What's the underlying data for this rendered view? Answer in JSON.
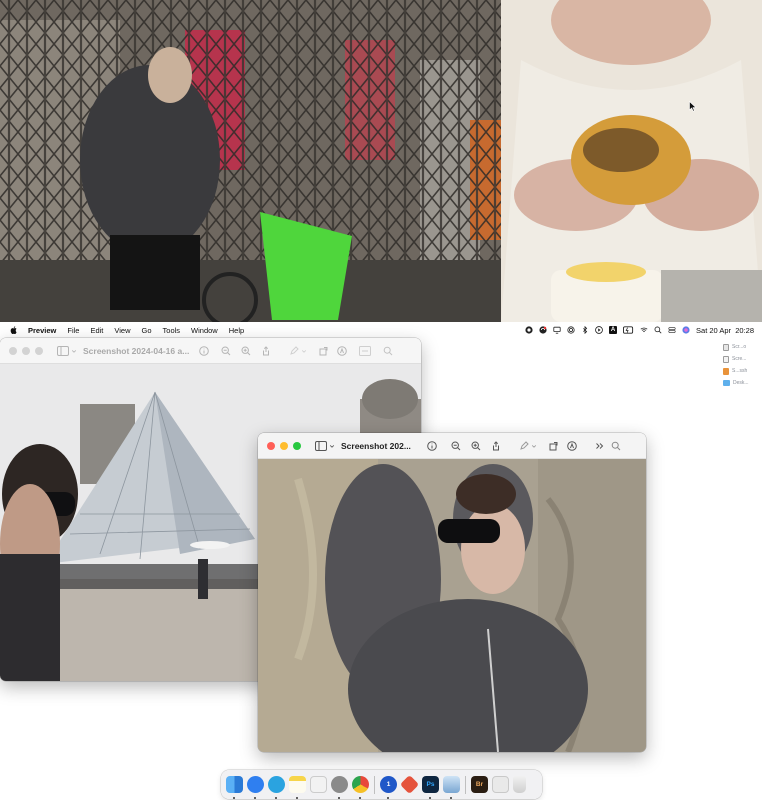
{
  "colors": {
    "menubar_bg": "#ffffff",
    "traffic_close": "#ff5f57",
    "traffic_minimize": "#febc2e",
    "traffic_zoom": "#28c840",
    "inactive_traffic": "#d3d3d3",
    "dock_bg": "#f0f0f2"
  },
  "menubar": {
    "apple_icon": "apple-icon",
    "items": [
      "Preview",
      "File",
      "Edit",
      "View",
      "Go",
      "Tools",
      "Window",
      "Help"
    ],
    "status_icons": [
      "creative-cloud-icon",
      "sync-icon",
      "display-icon",
      "airdrop-icon",
      "bluetooth-icon",
      "play-icon",
      "keyboard-a-icon",
      "battery-icon",
      "wifi-icon",
      "search-icon",
      "toggle-icon",
      "siri-icon"
    ],
    "keyboard_label": "A",
    "datetime": "Sat 20 Apr  20:28"
  },
  "desktop_files": [
    {
      "name": "Scr...o",
      "icon": "document-icon"
    },
    {
      "name": "Scre...",
      "icon": "document-icon"
    },
    {
      "name": "S...ssh",
      "icon": "image-file-icon"
    },
    {
      "name": "Desk...",
      "icon": "folder-icon"
    }
  ],
  "windows": [
    {
      "id": "back",
      "title": "Screenshot 2024-04-16 a...",
      "active": false,
      "toolbar_icons": [
        "sidebar-icon",
        "chevron-down-icon",
        "info-icon",
        "zoom-out-icon",
        "zoom-in-icon",
        "share-icon",
        "markup-icon",
        "chevron-down-icon",
        "rotate-icon",
        "markup-circle-icon",
        "form-fill-icon",
        "search-icon"
      ]
    },
    {
      "id": "front",
      "title": "Screenshot 202...",
      "active": true,
      "toolbar_icons": [
        "sidebar-icon",
        "chevron-down-icon",
        "info-icon",
        "zoom-out-icon",
        "zoom-in-icon",
        "share-icon",
        "markup-icon",
        "chevron-down-icon",
        "rotate-icon",
        "markup-circle-icon",
        "overflow-icon",
        "search-icon"
      ]
    }
  ],
  "dock": {
    "apps": [
      {
        "name": "finder",
        "color": "#3d8fe6",
        "label": ""
      },
      {
        "name": "safari",
        "color": "#2f7ff0",
        "label": ""
      },
      {
        "name": "telegram",
        "color": "#2aa3e0",
        "label": ""
      },
      {
        "name": "notes",
        "color": "#f7d54a",
        "label": ""
      },
      {
        "name": "freeform",
        "color": "#f2f2f2",
        "label": ""
      },
      {
        "name": "system-settings",
        "color": "#8a8a8a",
        "label": ""
      },
      {
        "name": "chrome",
        "color": "#e8483b",
        "label": ""
      },
      {
        "name": "onepassword",
        "color": "#1f57c8",
        "label": "1"
      },
      {
        "name": "git-client",
        "color": "#e5533c",
        "label": ""
      },
      {
        "name": "photoshop",
        "color": "#0e2640",
        "label": "Ps"
      },
      {
        "name": "preview",
        "color": "#8fb6dc",
        "label": ""
      },
      {
        "name": "bridge",
        "color": "#2a1d12",
        "label": "Br"
      },
      {
        "name": "downloads-stack",
        "color": "#e9e9e9",
        "label": ""
      },
      {
        "name": "trash",
        "color": "#dcdcdc",
        "label": ""
      }
    ]
  }
}
